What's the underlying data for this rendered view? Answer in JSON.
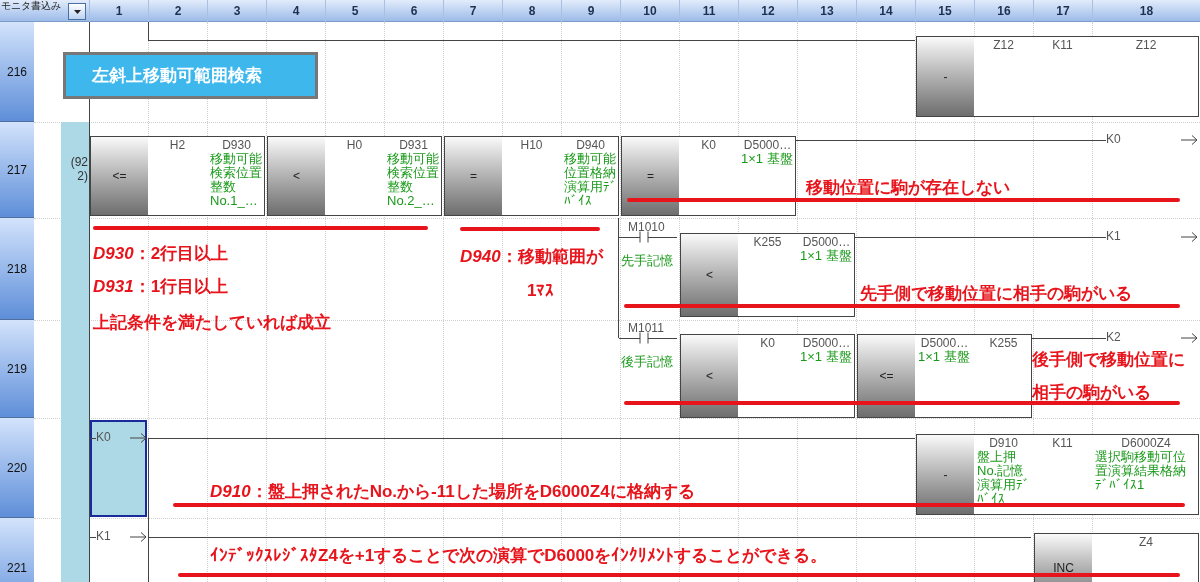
{
  "header": {
    "mode_label": "モニタ書込み",
    "columns": [
      "1",
      "2",
      "3",
      "4",
      "5",
      "6",
      "7",
      "8",
      "9",
      "10",
      "11",
      "12",
      "13",
      "14",
      "15",
      "16",
      "17",
      "18"
    ]
  },
  "rungs": [
    {
      "number": "216",
      "elements": [
        {
          "kind": "statement",
          "text": "左斜上移動可範囲検索",
          "selected": false
        },
        {
          "kind": "block",
          "op": "-",
          "operands": [
            {
              "device": "Z12"
            },
            {
              "device": "K11"
            },
            {
              "device": "Z12"
            }
          ],
          "selected": false
        }
      ]
    },
    {
      "number": "217",
      "step": "(922)",
      "elements": [
        {
          "kind": "block",
          "op": "<=",
          "operands": [
            {
              "device": "H2"
            },
            {
              "device": "D930",
              "comment": "移動可能検索位置整数No.1_…"
            }
          ],
          "selected": false
        },
        {
          "kind": "block",
          "op": "<",
          "operands": [
            {
              "device": "H0"
            },
            {
              "device": "D931",
              "comment": "移動可能検索位置整数No.2_…"
            }
          ],
          "selected": false
        },
        {
          "kind": "block",
          "op": "=",
          "operands": [
            {
              "device": "H10"
            },
            {
              "device": "D940",
              "comment": "移動可能位置格納演算用ﾃﾞﾊﾞｲｽ"
            }
          ],
          "selected": false
        },
        {
          "kind": "block",
          "op": "=",
          "operands": [
            {
              "device": "K0"
            },
            {
              "device": "D5000…",
              "comment": "1×1 基盤"
            }
          ],
          "selected": false
        },
        {
          "kind": "label",
          "text": "K0",
          "selected": false
        }
      ]
    },
    {
      "number": "218",
      "elements": [
        {
          "kind": "contact",
          "device": "M1010",
          "comment": "先手記憶",
          "selected": false
        },
        {
          "kind": "block",
          "op": "<",
          "operands": [
            {
              "device": "K255"
            },
            {
              "device": "D5000…",
              "comment": "1×1 基盤"
            }
          ],
          "selected": false
        },
        {
          "kind": "label",
          "text": "K1",
          "selected": false
        }
      ]
    },
    {
      "number": "219",
      "elements": [
        {
          "kind": "contact",
          "device": "M1011",
          "comment": "後手記憶",
          "selected": false
        },
        {
          "kind": "block",
          "op": "<",
          "operands": [
            {
              "device": "K0"
            },
            {
              "device": "D5000…",
              "comment": "1×1 基盤"
            }
          ],
          "selected": false
        },
        {
          "kind": "block",
          "op": "<=",
          "operands": [
            {
              "device": "D5000…",
              "comment": "1×1 基盤"
            },
            {
              "device": "K255"
            }
          ],
          "selected": false
        },
        {
          "kind": "label",
          "text": "K2",
          "selected": false
        }
      ]
    },
    {
      "number": "220",
      "elements": [
        {
          "kind": "label",
          "text": "K0",
          "selected": true
        },
        {
          "kind": "block",
          "op": "-",
          "operands": [
            {
              "device": "D910",
              "comment": "盤上押No.記憶演算用ﾃﾞﾊﾞｲｽ"
            },
            {
              "device": "K11"
            },
            {
              "device": "D6000Z4",
              "comment": "選択駒移動可位置演算結果格納ﾃﾞﾊﾞｲｽ1"
            }
          ],
          "selected": false
        }
      ]
    },
    {
      "number": "221",
      "elements": [
        {
          "kind": "label",
          "text": "K1",
          "selected": false
        },
        {
          "kind": "block",
          "op": "INC",
          "operands": [
            {
              "device": "Z4"
            }
          ],
          "selected": false
        }
      ]
    }
  ],
  "annotations": [
    {
      "lines": [
        "*D930*：2行目以上",
        "*D931*：1行目以上",
        "上記条件を満たしていれば成立"
      ]
    },
    {
      "lines": [
        "*D940*：移動範囲が",
        "1ﾏｽ"
      ]
    },
    {
      "lines": [
        "移動位置に駒が存在しない"
      ]
    },
    {
      "lines": [
        "先手側で移動位置に相手の駒がいる"
      ]
    },
    {
      "lines": [
        "後手側で移動位置に",
        "相手の駒がいる"
      ]
    },
    {
      "lines": [
        "*D910*：盤上押されたNo.から-11した場所をD6000Z4に格納する"
      ]
    },
    {
      "lines": [
        "ｲﾝﾃﾞｯｸｽﾚｼﾞｽﾀZ4を+1することで次の演算でD6000をｲﾝｸﾘﾒﾝﾄすることができる。"
      ]
    }
  ]
}
